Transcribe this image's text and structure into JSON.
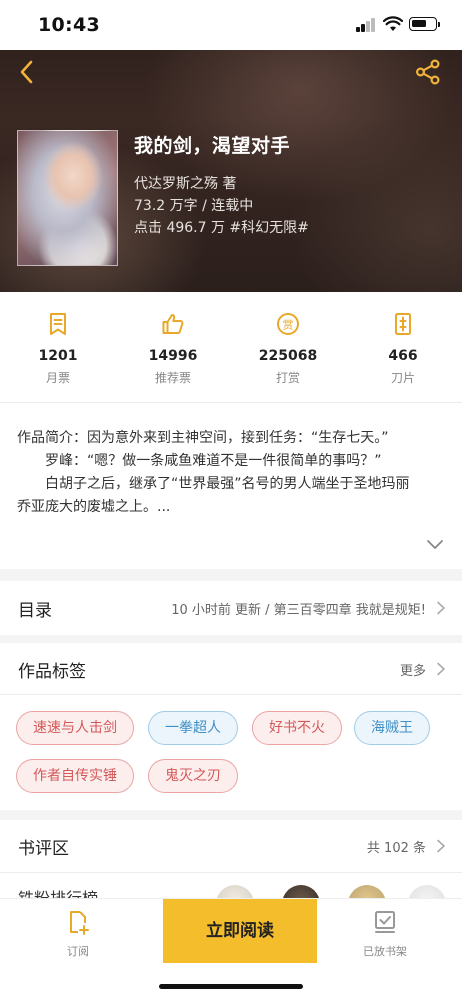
{
  "status_bar": {
    "time": "10:43"
  },
  "book": {
    "title": "我的剑，渴望对手",
    "author": "代达罗斯之殇  著",
    "meta": "73.2 万字 / 连载中",
    "clicks": "点击 496.7 万  #科幻无限#"
  },
  "stats": [
    {
      "icon": "monthly-ticket-icon",
      "value": "1201",
      "label": "月票"
    },
    {
      "icon": "thumbs-up-icon",
      "value": "14996",
      "label": "推荐票"
    },
    {
      "icon": "reward-coin-icon",
      "value": "225068",
      "label": "打赏"
    },
    {
      "icon": "blade-icon",
      "value": "466",
      "label": "刀片"
    }
  ],
  "intro": {
    "line1": "作品简介：因为意外来到主神空间，接到任务：“生存七天。”",
    "line2": "　　罗峰：“嗯？做一条咸鱼难道不是一件很简单的事吗？”",
    "line3": "　　白胡子之后，继承了“世界最强”名号的男人端坐于圣地玛丽",
    "line4": "乔亚庞大的废墟之上。..."
  },
  "catalog": {
    "title": "目录",
    "latest": "10 小时前 更新 / 第三百零四章 我就是规矩!"
  },
  "tags_section": {
    "title": "作品标签",
    "more": "更多",
    "tags": [
      {
        "label": "速速与人击剑",
        "color": "red"
      },
      {
        "label": "一拳超人",
        "color": "blue"
      },
      {
        "label": "好书不火",
        "color": "red"
      },
      {
        "label": "海贼王",
        "color": "blue"
      },
      {
        "label": "作者自传实锤",
        "color": "red"
      },
      {
        "label": "鬼灭之刃",
        "color": "red"
      }
    ]
  },
  "reviews": {
    "title": "书评区",
    "count": "共 102 条",
    "peek_text": "铁粉排行榜"
  },
  "bottom_bar": {
    "subscribe": "订阅",
    "read_now": "立即阅读",
    "on_shelf": "已放书架"
  },
  "colors": {
    "accent": "#f4bd2c",
    "icon_gold": "#e8a92a",
    "tag_red": "#d45959",
    "tag_blue": "#3f8fc6"
  }
}
